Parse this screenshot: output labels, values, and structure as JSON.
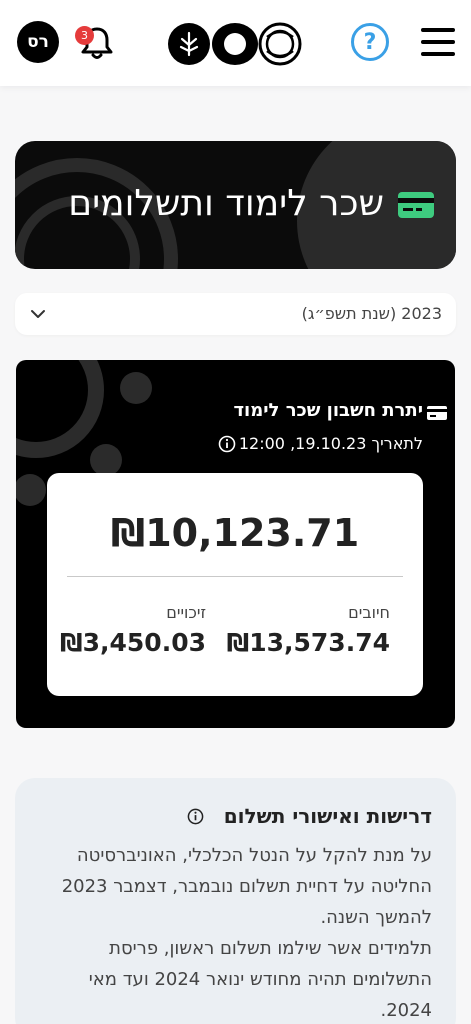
{
  "header": {
    "avatar_initials": "רס",
    "notification_count": "3",
    "help_label": "?",
    "icons": {
      "bell": "bell-icon",
      "logo": "university-logo",
      "menu": "hamburger-menu-icon",
      "help": "question-icon"
    }
  },
  "banner": {
    "title": "שכר לימוד ותשלומים",
    "icon": "credit-card-icon",
    "icon_color": "#3ecb7f"
  },
  "year_select": {
    "value": "2023 (שנת תשפ״ג)"
  },
  "balance": {
    "title": "יתרת חשבון שכר לימוד",
    "date": "לתאריך 19.10.23, 12:00",
    "total": "₪10,123.71",
    "debits_label": "חיובים",
    "debits_value": "₪13,573.74",
    "credits_label": "זיכויים",
    "credits_value": "₪3,450.03"
  },
  "info": {
    "title": "דרישות ואישורי תשלום",
    "paragraph1": "על מנת להקל על הנטל הכלכלי, האוניברסיטה החליטה על דחיית תשלום נובמבר, דצמבר 2023 להמשך השנה.",
    "paragraph2": "תלמידים אשר שילמו תשלום ראשון, פריסת התשלומים תהיה מחודש ינואר 2024 ועד מאי 2024."
  },
  "colors": {
    "accent_blue": "#3aa0e6",
    "badge_red": "#e53b3b",
    "card_black": "#000000",
    "info_bg": "#ebeff3"
  }
}
